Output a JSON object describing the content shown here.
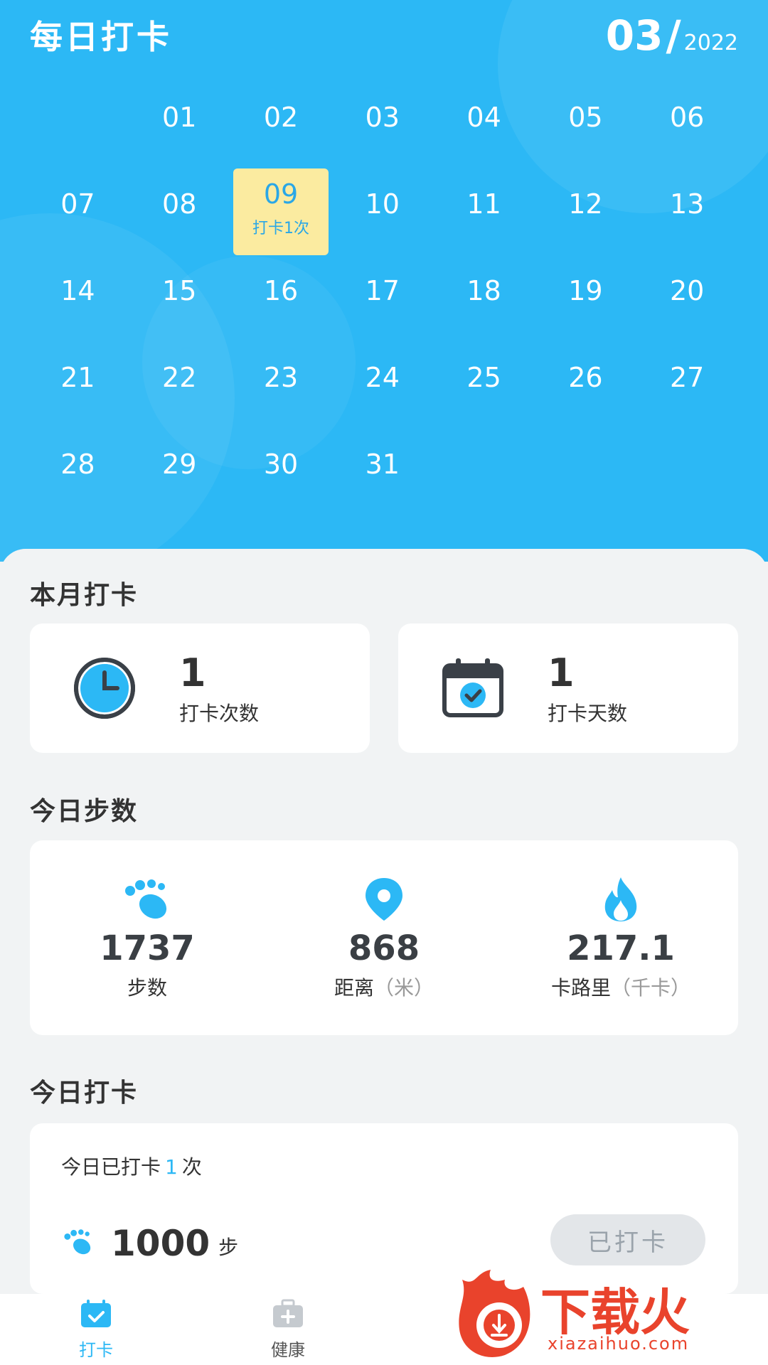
{
  "header": {
    "title": "每日打卡",
    "month": "03",
    "slash": "/",
    "year": "2022"
  },
  "calendar": {
    "days": [
      {
        "d": "",
        "empty": true
      },
      {
        "d": "01"
      },
      {
        "d": "02"
      },
      {
        "d": "03"
      },
      {
        "d": "04"
      },
      {
        "d": "05"
      },
      {
        "d": "06"
      },
      {
        "d": "07"
      },
      {
        "d": "08"
      },
      {
        "d": "09",
        "active": true,
        "sub": "打卡1次"
      },
      {
        "d": "10"
      },
      {
        "d": "11"
      },
      {
        "d": "12"
      },
      {
        "d": "13"
      },
      {
        "d": "14"
      },
      {
        "d": "15"
      },
      {
        "d": "16"
      },
      {
        "d": "17"
      },
      {
        "d": "18"
      },
      {
        "d": "19"
      },
      {
        "d": "20"
      },
      {
        "d": "21"
      },
      {
        "d": "22"
      },
      {
        "d": "23"
      },
      {
        "d": "24"
      },
      {
        "d": "25"
      },
      {
        "d": "26"
      },
      {
        "d": "27"
      },
      {
        "d": "28"
      },
      {
        "d": "29"
      },
      {
        "d": "30"
      },
      {
        "d": "31"
      }
    ]
  },
  "month_summary": {
    "title": "本月打卡",
    "checkin_count": {
      "value": "1",
      "label": "打卡次数",
      "icon": "clock-icon"
    },
    "checkin_days": {
      "value": "1",
      "label": "打卡天数",
      "icon": "calendar-check-icon"
    }
  },
  "steps_today": {
    "title": "今日步数",
    "steps": {
      "value": "1737",
      "label": "步数",
      "icon": "footprint-icon"
    },
    "distance": {
      "value": "868",
      "label": "距离",
      "unit": "（米）",
      "icon": "location-pin-icon"
    },
    "calories": {
      "value": "217.1",
      "label": "卡路里",
      "unit": "（千卡）",
      "icon": "flame-icon"
    }
  },
  "today_checkin": {
    "title": "今日打卡",
    "prefix": "今日已打卡",
    "count": "1",
    "suffix": "次",
    "goal_value": "1000",
    "goal_unit": "步",
    "button_label": "已打卡"
  },
  "bottom_nav": {
    "items": [
      {
        "label": "打卡",
        "icon": "calendar-check-icon",
        "active": true
      },
      {
        "label": "健康",
        "icon": "medical-kit-icon",
        "active": false
      }
    ]
  },
  "watermark": {
    "brand": "下载火",
    "url": "xiazaihuo.com"
  },
  "colors": {
    "primary": "#2cb8f5",
    "highlight": "#fbeba0",
    "watermark": "#e9432c"
  }
}
